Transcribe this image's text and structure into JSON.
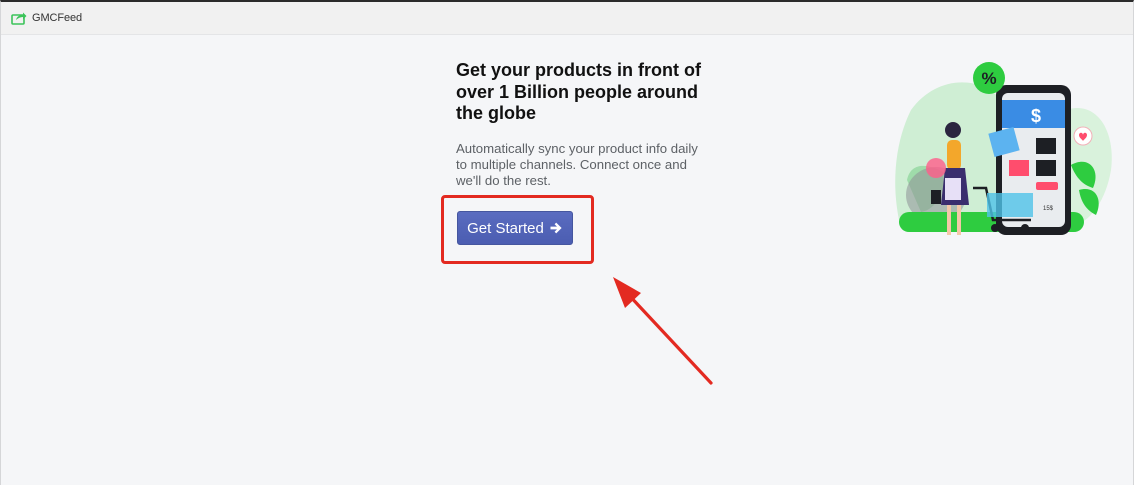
{
  "app": {
    "title": "GMCFeed",
    "icon": "share-arrow-icon"
  },
  "hero": {
    "headline": "Get your products in front of over 1 Billion people around the globe",
    "description": "Automatically sync your product info daily to multiple channels. Connect once and we'll do the rest.",
    "cta_label": "Get Started",
    "cta_icon": "arrow-right-icon"
  },
  "illustration": {
    "phone_badges": [
      "%",
      "$"
    ],
    "price_tag": "15$"
  },
  "colors": {
    "accent": "#5062b8",
    "brand_green": "#2ecc40",
    "annotation_red": "#e32a21",
    "background": "#f5f6f8"
  }
}
